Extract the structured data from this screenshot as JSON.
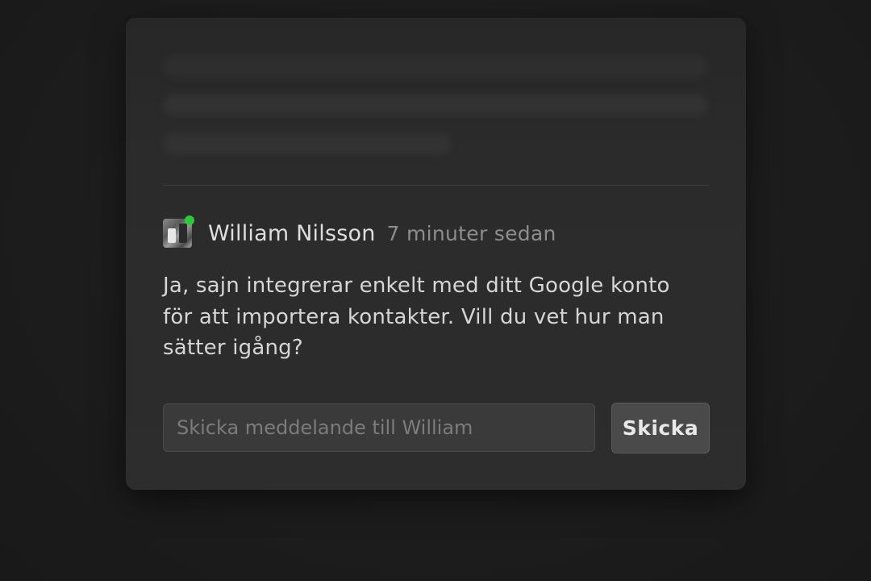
{
  "comment": {
    "author": "William Nilsson",
    "timestamp": "7 minuter sedan",
    "author_online": true,
    "body": "Ja, sajn integrerar enkelt med ditt Google konto för att importera kontakter. Vill du vet hur man sätter igång?"
  },
  "reply": {
    "placeholder": "Skicka meddelande till William",
    "value": "",
    "send_label": "Skicka"
  },
  "colors": {
    "background": "#1b1b1b",
    "card": "#2d2d2d",
    "online_indicator": "#2ec83a"
  }
}
